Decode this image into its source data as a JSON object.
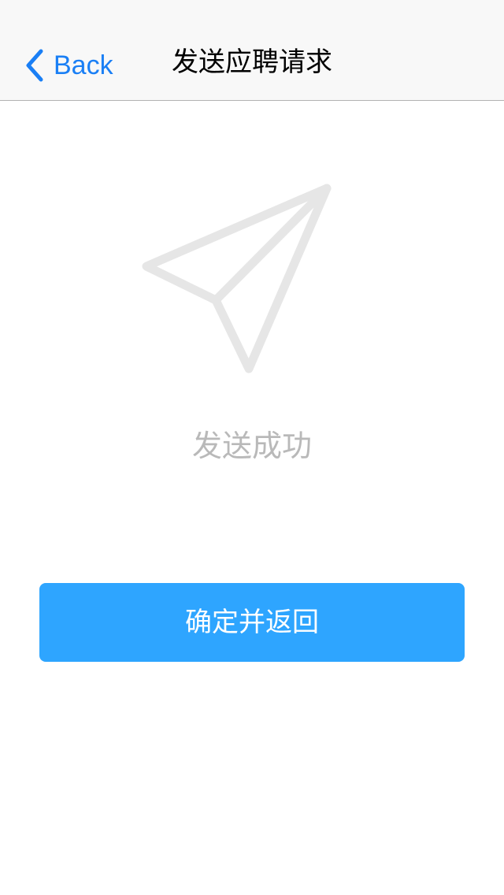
{
  "navbar": {
    "back_label": "Back",
    "title": "发送应聘请求"
  },
  "main": {
    "icon": "paper-plane-icon",
    "status_text": "发送成功",
    "confirm_label": "确定并返回"
  },
  "colors": {
    "accent": "#1a7ff5",
    "button": "#2ea5ff",
    "icon": "#e6e6e6",
    "status_text": "#b9b9b9",
    "navbar_bg": "#f8f8f8"
  }
}
